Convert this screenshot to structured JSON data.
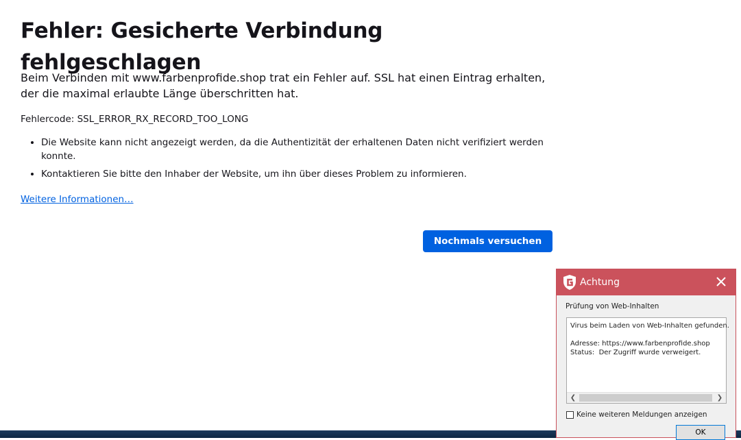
{
  "error_page": {
    "title": "Fehler: Gesicherte Verbindung fehlgeschlagen",
    "intro": "Beim Verbinden mit www.farbenprofide.shop trat ein Fehler auf. SSL hat einen Eintrag erhalten, der die maximal erlaubte Länge überschritten hat.",
    "error_code": "Fehlercode: SSL_ERROR_RX_RECORD_TOO_LONG",
    "reasons": [
      "Die Website kann nicht angezeigt werden, da die Authentizität der erhaltenen Daten nicht verifiziert werden konnte.",
      "Kontaktieren Sie bitte den Inhaber der Website, um ihn über dieses Problem zu informieren."
    ],
    "more_info_link": "Weitere Informationen…",
    "retry_button": "Nochmals versuchen",
    "accent_color": "#0061e0"
  },
  "popup": {
    "title": "Achtung",
    "logo_icon": "gdata-shield-icon",
    "close_icon": "close-icon",
    "header_color": "#cb525c",
    "section_label": "Prüfung von Web-Inhalten",
    "message": "Virus beim Laden von Web-Inhalten gefunden.\n\nAdresse: https://www.farbenprofide.shop\nStatus:  Der Zugriff wurde verweigert.",
    "checkbox_label": "Keine weiteren Meldungen anzeigen",
    "checkbox_checked": false,
    "ok_button": "OK"
  }
}
